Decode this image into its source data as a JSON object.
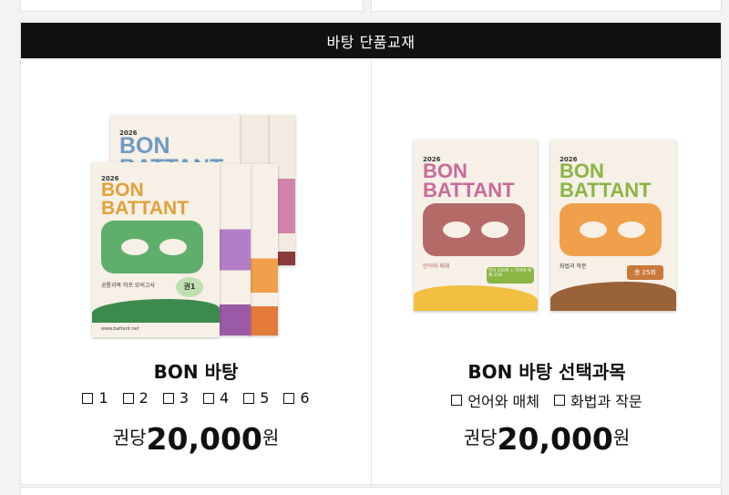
{
  "section_header": "바탕 단품교재",
  "products": [
    {
      "title": "BON 바탕",
      "options": [
        "1",
        "2",
        "3",
        "4",
        "5",
        "6"
      ],
      "price_prefix": "권당",
      "price": "20,000",
      "price_suffix": "원",
      "cover": {
        "year": "2026",
        "line1": "BON",
        "line2": "BATTANT",
        "subtitle": "공통과목 하프 모의고사",
        "badge": "권1"
      }
    },
    {
      "title": "BON 바탕 선택과목",
      "options": [
        "언어와 매체",
        "화법과 작문"
      ],
      "price_prefix": "권당",
      "price": "20,000",
      "price_suffix": "원",
      "covers": [
        {
          "year": "2026",
          "line1": "BON",
          "line2": "BATTANT",
          "subtitle": "언어와 매체",
          "badge": "언어 200제 + 언어와 매체 15회"
        },
        {
          "year": "2026",
          "line1": "BON",
          "line2": "BATTANT",
          "subtitle": "화법과 작문",
          "badge": "총 25회"
        }
      ]
    }
  ],
  "colors": {
    "header_bg": "#111111",
    "green": "#5fae6b",
    "blue": "#6f9bc4",
    "pink": "#c96a9c",
    "rose": "#b46a66",
    "orange": "#f0a04a",
    "olive": "#8bb545"
  }
}
